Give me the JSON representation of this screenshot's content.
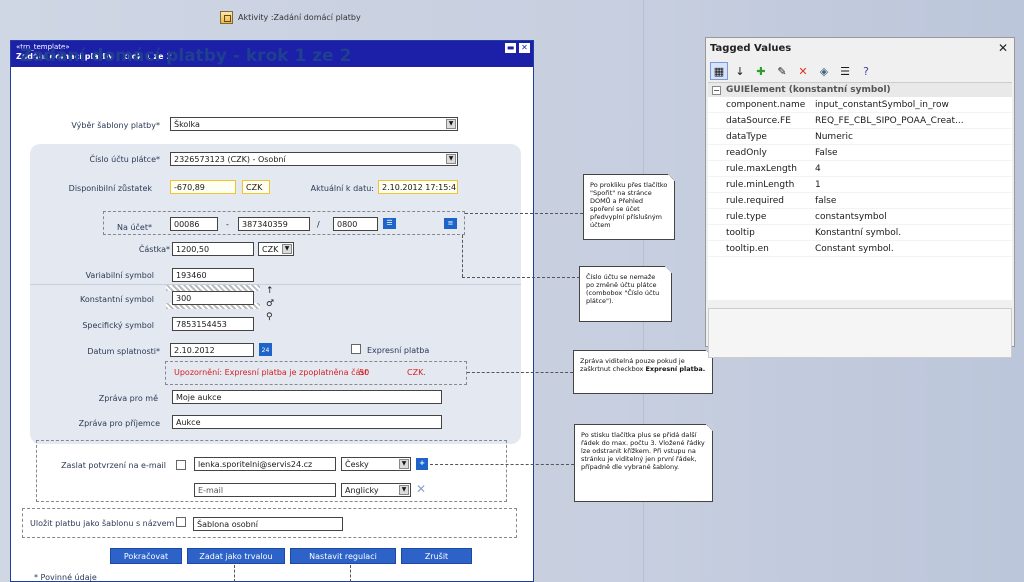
{
  "activity": {
    "label": "Aktivity :Zadání domácí platby"
  },
  "window": {
    "stereotype": "«trn_template»",
    "title": "Zadání domácí platby - krok 1 ze 2",
    "heading": "Zadání domácí platby - krok 1 ze 2"
  },
  "form": {
    "template_label": "Výběr šablony platby*",
    "template_value": "Školka",
    "account_label": "Číslo účtu plátce*",
    "account_value": "2326573123 (CZK) - Osobní",
    "balance_label": "Disponibilní zůstatek",
    "balance_value": "-670,89",
    "balance_currency": "CZK",
    "actual_label": "Aktuální k datu:",
    "actual_value": "2.10.2012 17:15:41",
    "to_account_label": "Na účet*",
    "to_prefix": "00086",
    "to_dash": "-",
    "to_number": "387340359",
    "to_slash": "/",
    "to_bank": "0800",
    "amount_label": "Částka*",
    "amount_value": "1200,50",
    "amount_currency": "CZK",
    "var_symbol_label": "Variabilní symbol",
    "var_symbol_value": "193460",
    "const_symbol_label": "Konstantní symbol",
    "const_symbol_value": "300",
    "spec_symbol_label": "Specifický symbol",
    "spec_symbol_value": "7853154453",
    "due_label": "Datum splatnosti*",
    "due_value": "2.10.2012",
    "calendar_day": "24",
    "express_label": "Expresní platba",
    "warning_text": "Upozornění: Expresní platba je zpoplatněna část",
    "warning_amount": "50",
    "warning_currency": "CZK.",
    "msg_me_label": "Zpráva pro mě",
    "msg_me_value": "Moje aukce",
    "msg_recipient_label": "Zpráva pro příjemce",
    "msg_recipient_value": "Aukce",
    "email_label": "Zaslat potvrzení na e-mail",
    "email_1_value": "lenka.sporitelni@servis24.cz",
    "email_1_lang": "Česky",
    "email_2_placeholder": "E-mail",
    "email_2_lang": "Anglicky",
    "save_template_label": "Uložit platbu jako šablonu s názvem",
    "save_template_value": "Šablona osobní",
    "required_note": "* Povinné údaje"
  },
  "buttons": {
    "continue": "Pokračovat",
    "standing_order": "Zadat jako trvalou platbu",
    "balance_regulation": "Nastavit regulaci zůstatku",
    "cancel": "Zrušit"
  },
  "notes": {
    "note1": "Po prokliku přes tlačítko \"Spořit\" na stránce DOMŮ a Přehled spoření se účet předvyplní příslušným účtem",
    "note2": "Číslo účtu se nemaže po změně účtu plátce (combobox \"Číslo účtu plátce\").",
    "note3a": "Zpráva viditelná pouze pokud je zaškrtnut checkbox",
    "note3b": "Expresní platba.",
    "note4": "Po stisku tlačítka plus se přidá další řádek do max. počtu 3. Vložené řádky lze odstranit křížkem. Při vstupu na stránku je viditelný jen první řádek, případně dle vybrané šablony."
  },
  "tagged_values": {
    "title": "Tagged Values",
    "group": "GUIElement (konstantní symbol)",
    "rows": [
      {
        "key": "component.name",
        "value": "input_constantSymbol_in_row"
      },
      {
        "key": "dataSource.FE",
        "value": "REQ_FE_CBL_SIPO_POAA_Creat..."
      },
      {
        "key": "dataType",
        "value": "Numeric"
      },
      {
        "key": "readOnly",
        "value": "False"
      },
      {
        "key": "rule.maxLength",
        "value": "4"
      },
      {
        "key": "rule.minLength",
        "value": "1"
      },
      {
        "key": "rule.required",
        "value": "false"
      },
      {
        "key": "rule.type",
        "value": "constantsymbol"
      },
      {
        "key": "tooltip",
        "value": "Konstantní symbol."
      },
      {
        "key": "tooltip.en",
        "value": "Constant symbol."
      }
    ]
  }
}
